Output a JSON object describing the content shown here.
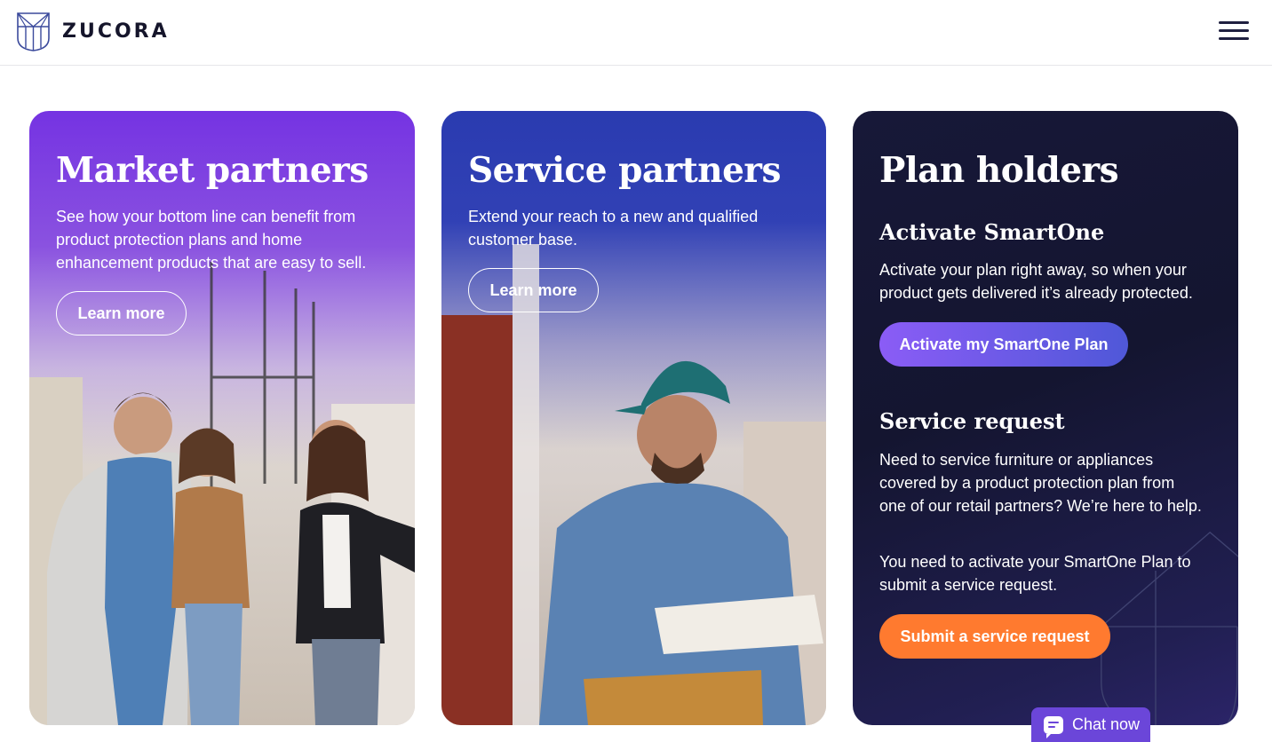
{
  "header": {
    "logo_text": "ZUCORA",
    "menu_label": "Menu"
  },
  "cards": {
    "market": {
      "title": "Market partners",
      "text": "See how your bottom line can benefit from product protection plans and home enhancement products that are easy to sell.",
      "button": "Learn more"
    },
    "service": {
      "title": "Service partners",
      "text": "Extend your reach to a new and qualified customer base.",
      "button": "Learn more"
    },
    "plan": {
      "title": "Plan holders",
      "activate_heading": "Activate SmartOne",
      "activate_text": "Activate your plan right away, so when your product gets delivered it’s already protected.",
      "activate_button": "Activate my SmartOne Plan",
      "service_heading": "Service request",
      "service_text": "Need to service furniture or appliances covered by a product protection plan from one of our retail partners? We’re here to help.",
      "service_note": "You need to activate your SmartOne Plan to submit a service request.",
      "service_button": "Submit a service request"
    }
  },
  "chat": {
    "label": "Chat now"
  },
  "colors": {
    "market_purple": "#7533e2",
    "service_blue": "#2a3bb0",
    "plan_navy": "#171838",
    "activate_gradient_start": "#8b5cf6",
    "activate_gradient_end": "#4f58d8",
    "submit_orange": "#ff7a2f",
    "chat_purple": "#6b46d9"
  }
}
